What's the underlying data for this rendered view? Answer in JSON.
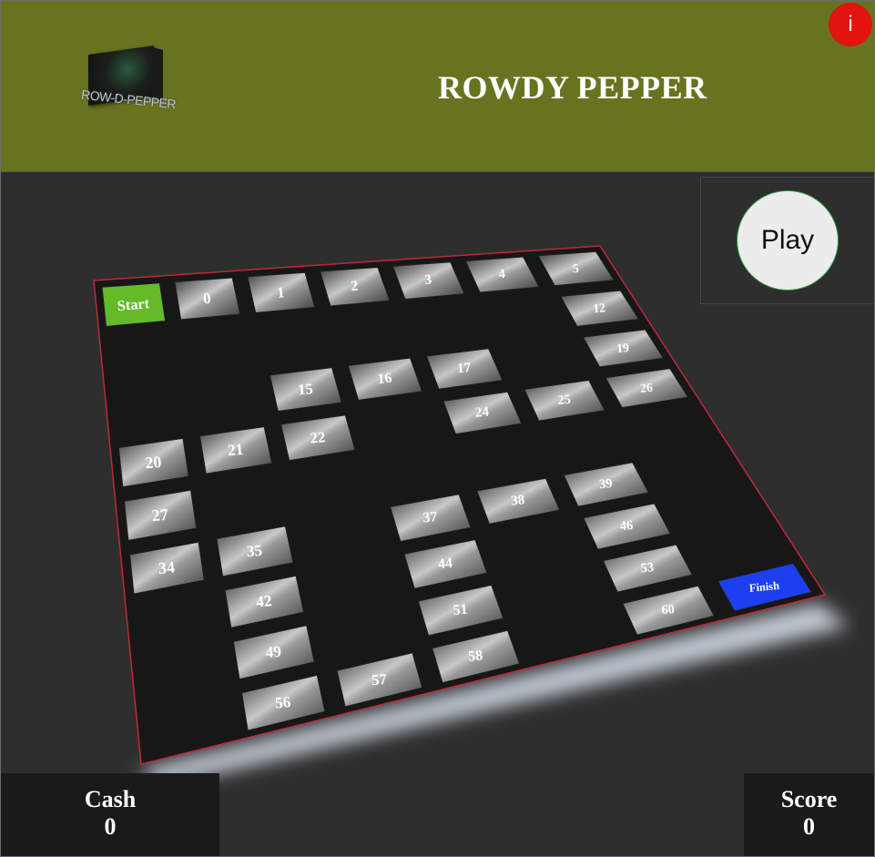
{
  "header": {
    "title": "ROWDY PEPPER",
    "logo_text": "ROW-D-PEPPER",
    "info_label": "i"
  },
  "controls": {
    "play_label": "Play"
  },
  "stats": {
    "cash_label": "Cash",
    "cash_value": "0",
    "score_label": "Score",
    "score_value": "0"
  },
  "colors": {
    "header_bg": "#687320",
    "start": "#63bb2a",
    "finish": "#1e3ff0",
    "board": "#171717",
    "board_border": "#c0283a",
    "info": "#e2140f"
  },
  "board": {
    "grid_columns": 7,
    "grid_rows": 9,
    "tiles": [
      {
        "label": "Start",
        "kind": "start",
        "row": 0,
        "col": 0
      },
      {
        "label": "0",
        "kind": "path",
        "row": 0,
        "col": 1
      },
      {
        "label": "1",
        "kind": "path",
        "row": 0,
        "col": 2
      },
      {
        "label": "2",
        "kind": "path",
        "row": 0,
        "col": 3
      },
      {
        "label": "3",
        "kind": "path",
        "row": 0,
        "col": 4
      },
      {
        "label": "4",
        "kind": "path",
        "row": 0,
        "col": 5
      },
      {
        "label": "5",
        "kind": "path",
        "row": 0,
        "col": 6
      },
      {
        "label": "12",
        "kind": "path",
        "row": 1,
        "col": 6
      },
      {
        "label": "15",
        "kind": "path",
        "row": 2,
        "col": 2
      },
      {
        "label": "16",
        "kind": "path",
        "row": 2,
        "col": 3
      },
      {
        "label": "17",
        "kind": "path",
        "row": 2,
        "col": 4
      },
      {
        "label": "19",
        "kind": "path",
        "row": 2,
        "col": 6
      },
      {
        "label": "20",
        "kind": "path",
        "row": 3,
        "col": 0
      },
      {
        "label": "21",
        "kind": "path",
        "row": 3,
        "col": 1
      },
      {
        "label": "22",
        "kind": "path",
        "row": 3,
        "col": 2
      },
      {
        "label": "24",
        "kind": "path",
        "row": 3,
        "col": 4
      },
      {
        "label": "25",
        "kind": "path",
        "row": 3,
        "col": 5
      },
      {
        "label": "26",
        "kind": "path",
        "row": 3,
        "col": 6
      },
      {
        "label": "27",
        "kind": "path",
        "row": 4,
        "col": 0
      },
      {
        "label": "34",
        "kind": "path",
        "row": 5,
        "col": 0
      },
      {
        "label": "35",
        "kind": "path",
        "row": 5,
        "col": 1
      },
      {
        "label": "37",
        "kind": "path",
        "row": 5,
        "col": 3
      },
      {
        "label": "38",
        "kind": "path",
        "row": 5,
        "col": 4
      },
      {
        "label": "39",
        "kind": "path",
        "row": 5,
        "col": 5
      },
      {
        "label": "42",
        "kind": "path",
        "row": 6,
        "col": 1
      },
      {
        "label": "44",
        "kind": "path",
        "row": 6,
        "col": 3
      },
      {
        "label": "46",
        "kind": "path",
        "row": 6,
        "col": 5
      },
      {
        "label": "49",
        "kind": "path",
        "row": 7,
        "col": 1
      },
      {
        "label": "51",
        "kind": "path",
        "row": 7,
        "col": 3
      },
      {
        "label": "53",
        "kind": "path",
        "row": 7,
        "col": 5
      },
      {
        "label": "56",
        "kind": "path",
        "row": 8,
        "col": 1
      },
      {
        "label": "57",
        "kind": "path",
        "row": 8,
        "col": 2
      },
      {
        "label": "58",
        "kind": "path",
        "row": 8,
        "col": 3
      },
      {
        "label": "60",
        "kind": "path",
        "row": 8,
        "col": 5
      },
      {
        "label": "Finish",
        "kind": "finish",
        "row": 8,
        "col": 6
      }
    ]
  }
}
